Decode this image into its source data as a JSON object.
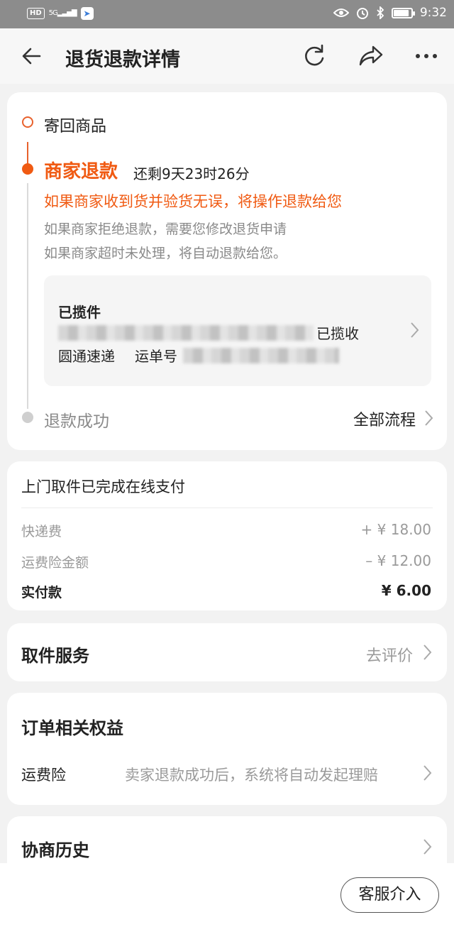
{
  "status_bar": {
    "hd_badge": "HD",
    "signal_text": "5G",
    "time": "9:32"
  },
  "nav": {
    "title": "退货退款详情"
  },
  "timeline": {
    "step_shipped": "寄回商品",
    "active_title": "商家退款",
    "time_remaining": "还剩9天23时26分",
    "orange_note": "如果商家收到货并验货无误，将操作退款给您",
    "grey_note_1": "如果商家拒绝退款，需要您修改退货申请",
    "grey_note_2": "如果商家超时未处理，将自动退款给您。",
    "logistics": {
      "title": "已揽件",
      "status_suffix": "已揽收",
      "courier": "圆通速递",
      "waybill_label": "运单号"
    },
    "final_step": "退款成功",
    "all_process": "全部流程"
  },
  "fees": {
    "header": "上门取件已完成在线支付",
    "rows": [
      {
        "label": "快递费",
        "value": "+ ¥ 18.00"
      },
      {
        "label": "运费险金额",
        "value": "– ¥ 12.00"
      },
      {
        "label": "实付款",
        "value": "¥ 6.00"
      }
    ]
  },
  "pickup_service": {
    "title": "取件服务",
    "link": "去评价"
  },
  "order_benefits": {
    "title": "订单相关权益",
    "insurance_label": "运费险",
    "insurance_text": "卖家退款成功后，系统将自动发起理赔"
  },
  "negotiation": {
    "title": "协商历史"
  },
  "bottom": {
    "cs_button": "客服介入"
  },
  "colors": {
    "accent": "#f05a12",
    "status_bar": "#8c8c8c",
    "background": "#f2f2f2"
  },
  "icons": [
    "back-arrow-icon",
    "refresh-icon",
    "share-icon",
    "more-icon",
    "chevron-right-icon",
    "eye-icon",
    "alarm-icon",
    "bluetooth-icon",
    "battery-icon"
  ]
}
